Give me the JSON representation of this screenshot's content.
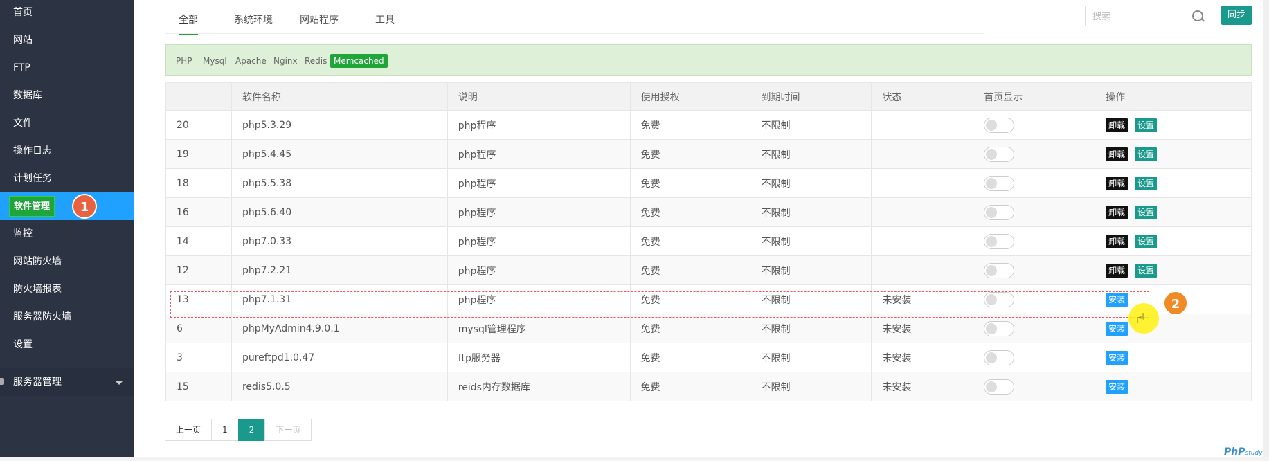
{
  "sidebar": {
    "items": [
      {
        "label": "首页"
      },
      {
        "label": "网站"
      },
      {
        "label": "FTP"
      },
      {
        "label": "数据库"
      },
      {
        "label": "文件"
      },
      {
        "label": "操作日志"
      },
      {
        "label": "计划任务"
      },
      {
        "label": "软件管理"
      },
      {
        "label": "监控"
      },
      {
        "label": "网站防火墙"
      },
      {
        "label": "防火墙报表"
      },
      {
        "label": "服务器防火墙"
      },
      {
        "label": "设置"
      }
    ],
    "sub_header": "服务器管理",
    "step1": "1"
  },
  "tabs": [
    {
      "label": "全部"
    },
    {
      "label": "系统环境"
    },
    {
      "label": "网站程序"
    },
    {
      "label": "工具"
    }
  ],
  "search": {
    "placeholder": "搜索"
  },
  "sync_label": "同步",
  "filters": [
    "PHP",
    "Mysql",
    "Apache",
    "Nginx",
    "Redis",
    "Memcached"
  ],
  "table": {
    "headers": [
      "",
      "软件名称",
      "说明",
      "使用授权",
      "到期时间",
      "状态",
      "首页显示",
      "操作"
    ],
    "rows": [
      {
        "id": "20",
        "name": "php5.3.29",
        "desc": "php程序",
        "license": "免费",
        "expire": "不限制",
        "status": ""
      },
      {
        "id": "19",
        "name": "php5.4.45",
        "desc": "php程序",
        "license": "免费",
        "expire": "不限制",
        "status": ""
      },
      {
        "id": "18",
        "name": "php5.5.38",
        "desc": "php程序",
        "license": "免费",
        "expire": "不限制",
        "status": ""
      },
      {
        "id": "16",
        "name": "php5.6.40",
        "desc": "php程序",
        "license": "免费",
        "expire": "不限制",
        "status": ""
      },
      {
        "id": "14",
        "name": "php7.0.33",
        "desc": "php程序",
        "license": "免费",
        "expire": "不限制",
        "status": ""
      },
      {
        "id": "12",
        "name": "php7.2.21",
        "desc": "php程序",
        "license": "免费",
        "expire": "不限制",
        "status": ""
      },
      {
        "id": "13",
        "name": "php7.1.31",
        "desc": "php程序",
        "license": "免费",
        "expire": "不限制",
        "status": "未安装"
      },
      {
        "id": "6",
        "name": "phpMyAdmin4.9.0.1",
        "desc": "mysql管理程序",
        "license": "免费",
        "expire": "不限制",
        "status": "未安装"
      },
      {
        "id": "3",
        "name": "pureftpd1.0.47",
        "desc": "ftp服务器",
        "license": "免费",
        "expire": "不限制",
        "status": "未安装"
      },
      {
        "id": "15",
        "name": "redis5.0.5",
        "desc": "reids内存数据库",
        "license": "免费",
        "expire": "不限制",
        "status": "未安装"
      }
    ],
    "uninstall_label": "卸载",
    "settings_label": "设置",
    "install_label": "安装"
  },
  "step2": "2",
  "pagination": {
    "prev": "上一页",
    "pages": [
      "1",
      "2"
    ],
    "current": "2",
    "next": "下一页"
  },
  "watermark": {
    "main": "PhP",
    "sub": "study"
  },
  "colors": {
    "sidebar_bg": "#2c3342",
    "active_nav": "#20a0ff",
    "green": "#20a53a",
    "teal": "#1a9a8c",
    "badge": "#e8623f"
  }
}
